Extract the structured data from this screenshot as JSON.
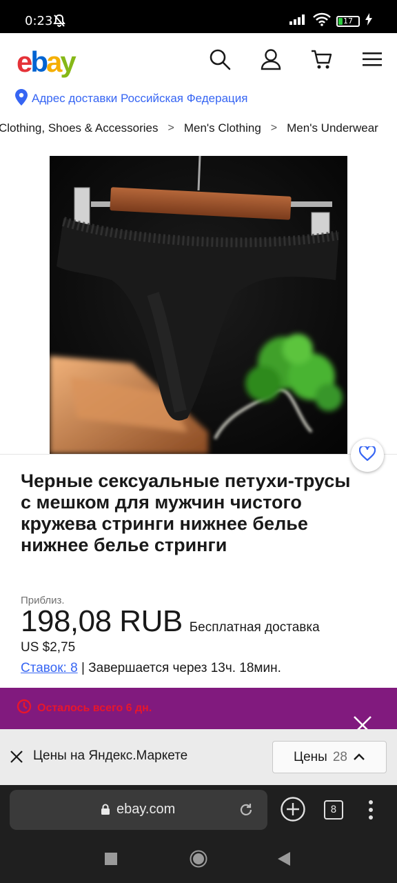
{
  "status_bar": {
    "time": "0:23",
    "battery": "17"
  },
  "header": {
    "logo": {
      "e": "e",
      "b": "b",
      "a": "a",
      "y": "y"
    },
    "icons": [
      "search-icon",
      "account-icon",
      "cart-icon",
      "menu-icon"
    ]
  },
  "location": {
    "text": "Адрес доставки Российская Федерация"
  },
  "breadcrumb": [
    {
      "label": "Clothing, Shoes & Accessories"
    },
    {
      "label": "Men's Clothing"
    },
    {
      "label": "Men's Underwear"
    }
  ],
  "product": {
    "title": "Черные сексуальные петухи-трусы с мешком для мужчин чистого кружева стринги нижнее белье нижнее белье стринги",
    "approx_label": "Приблиз.",
    "price": "198,08 RUB",
    "shipping": "Бесплатная доставка",
    "usd_price": "US $2,75",
    "bids_link": "Ставок: 8",
    "ends_text": " | Завершается через 13ч. 18мин."
  },
  "banner": {
    "text": "Осталось всего 6 дн.",
    "color": "#811a7e"
  },
  "yandex": {
    "text": "Цены на Яндекс.Маркете",
    "prices_label": "Цены",
    "prices_count": "28"
  },
  "browser": {
    "url": "ebay.com",
    "tab_count": "8"
  },
  "colors": {
    "link": "#3665f3",
    "ebay_red": "#e53238",
    "ebay_blue": "#0064d2",
    "ebay_yellow": "#f5af02",
    "ebay_green": "#86b817"
  }
}
